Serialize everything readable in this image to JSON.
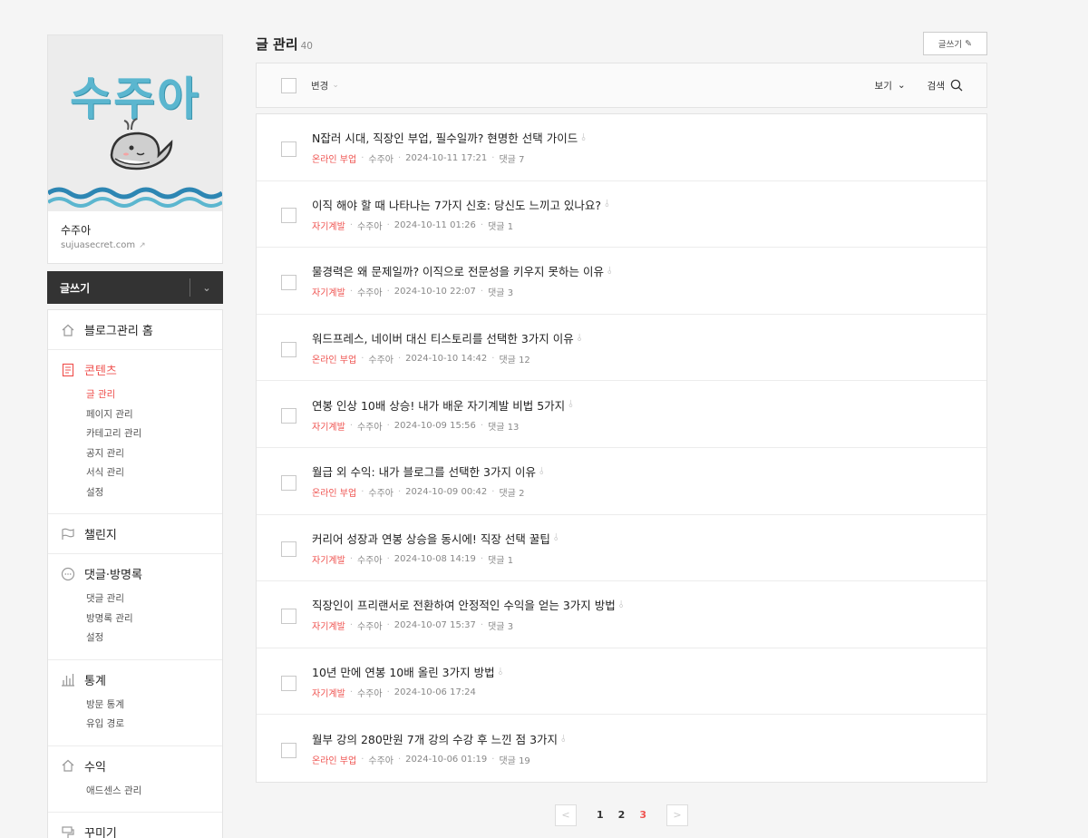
{
  "profile": {
    "logo_text": "수주아",
    "blog_name": "수주아",
    "blog_url": "sujuasecret.com"
  },
  "write_bar": {
    "label": "글쓰기"
  },
  "menu": [
    {
      "key": "home",
      "label": "블로그관리 홈",
      "icon": "home-icon",
      "sub": []
    },
    {
      "key": "content",
      "label": "콘텐츠",
      "icon": "document-icon",
      "active": true,
      "sub": [
        "글 관리",
        "페이지 관리",
        "카테고리 관리",
        "공지 관리",
        "서식 관리",
        "설정"
      ]
    },
    {
      "key": "challenge",
      "label": "챌린지",
      "icon": "flag-icon",
      "sub": []
    },
    {
      "key": "comments",
      "label": "댓글·방명록",
      "icon": "speech-bubble-icon",
      "sub": [
        "댓글 관리",
        "방명록 관리",
        "설정"
      ]
    },
    {
      "key": "stats",
      "label": "통계",
      "icon": "bar-chart-icon",
      "sub": [
        "방문 통계",
        "유입 경로"
      ]
    },
    {
      "key": "revenue",
      "label": "수익",
      "icon": "home-icon",
      "sub": [
        "애드센스 관리"
      ]
    },
    {
      "key": "design",
      "label": "꾸미기",
      "icon": "paint-icon",
      "sub": []
    }
  ],
  "header": {
    "title": "글 관리",
    "count": "40",
    "write_button": "글쓰기"
  },
  "toolbar": {
    "change_label": "변경",
    "view_label": "보기",
    "search_label": "검색"
  },
  "posts": [
    {
      "title": "N잡러 시대, 직장인 부업, 필수일까? 현명한 선택 가이드",
      "category": "온라인 부업",
      "author": "수주아",
      "date": "2024-10-11 17:21",
      "comments": "댓글 7"
    },
    {
      "title": "이직 해야 할 때 나타나는 7가지 신호: 당신도 느끼고 있나요?",
      "category": "자기계발",
      "author": "수주아",
      "date": "2024-10-11 01:26",
      "comments": "댓글 1"
    },
    {
      "title": "물경력은 왜 문제일까? 이직으로 전문성을 키우지 못하는 이유",
      "category": "자기계발",
      "author": "수주아",
      "date": "2024-10-10 22:07",
      "comments": "댓글 3"
    },
    {
      "title": "워드프레스, 네이버 대신 티스토리를 선택한 3가지 이유",
      "category": "온라인 부업",
      "author": "수주아",
      "date": "2024-10-10 14:42",
      "comments": "댓글 12"
    },
    {
      "title": "연봉 인상 10배 상승! 내가 배운 자기계발 비법 5가지",
      "category": "자기계발",
      "author": "수주아",
      "date": "2024-10-09 15:56",
      "comments": "댓글 13"
    },
    {
      "title": "월급 외 수익: 내가 블로그를 선택한 3가지 이유",
      "category": "온라인 부업",
      "author": "수주아",
      "date": "2024-10-09 00:42",
      "comments": "댓글 2"
    },
    {
      "title": "커리어 성장과 연봉 상승을 동시에! 직장 선택 꿀팁",
      "category": "자기계발",
      "author": "수주아",
      "date": "2024-10-08 14:19",
      "comments": "댓글 1"
    },
    {
      "title": "직장인이 프리랜서로 전환하여 안정적인 수익을 얻는 3가지 방법",
      "category": "자기계발",
      "author": "수주아",
      "date": "2024-10-07 15:37",
      "comments": "댓글 3"
    },
    {
      "title": "10년 만에 연봉 10배 올린 3가지 방법",
      "category": "자기계발",
      "author": "수주아",
      "date": "2024-10-06 17:24",
      "comments": ""
    },
    {
      "title": "월부 강의 280만원 7개 강의 수강 후 느낀 점 3가지",
      "category": "온라인 부업",
      "author": "수주아",
      "date": "2024-10-06 01:19",
      "comments": "댓글 19"
    }
  ],
  "pagination": {
    "pages": [
      "1",
      "2",
      "3"
    ],
    "current": "3"
  },
  "colors": {
    "accent": "#ef5350",
    "dark_bar": "#333333",
    "logo": "#5bb6cf"
  }
}
